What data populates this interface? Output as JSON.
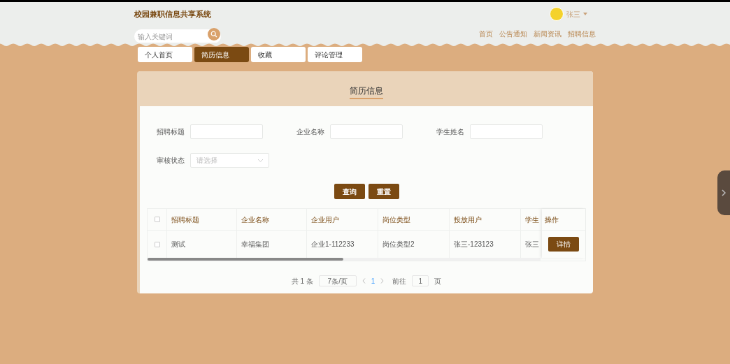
{
  "site_title": "校园兼职信息共享系统",
  "search": {
    "placeholder": "输入关键词"
  },
  "user": {
    "name": "张三"
  },
  "nav": [
    "首页",
    "公告通知",
    "新闻资讯",
    "招聘信息"
  ],
  "tabs": [
    {
      "label": "个人首页",
      "selected": false
    },
    {
      "label": "简历信息",
      "selected": true
    },
    {
      "label": "收藏",
      "selected": false
    },
    {
      "label": "评论管理",
      "selected": false
    }
  ],
  "panel_title": "简历信息",
  "filters": [
    {
      "kind": "text",
      "label": "招聘标题"
    },
    {
      "kind": "text",
      "label": "企业名称"
    },
    {
      "kind": "text",
      "label": "学生姓名"
    },
    {
      "kind": "select",
      "label": "审核状态",
      "placeholder": "请选择"
    }
  ],
  "buttons": [
    "查询",
    "重置"
  ],
  "table": {
    "all_checked": false,
    "columns": [
      "招聘标题",
      "企业名称",
      "企业用户",
      "岗位类型",
      "投放用户",
      "学生"
    ],
    "action_column": "操作",
    "rows": [
      {
        "checked": false,
        "cells": [
          "测试",
          "幸福集团",
          "企业1-112233",
          "岗位类型2",
          "张三-123123",
          "张三"
        ],
        "action": "详情"
      }
    ]
  },
  "pagination": {
    "total": "共 1 条",
    "page_size": "7条/页",
    "pages": [
      {
        "label": "1",
        "selected": true
      }
    ],
    "goto_label": "前往",
    "goto_value": "1",
    "goto_suffix": "页"
  }
}
